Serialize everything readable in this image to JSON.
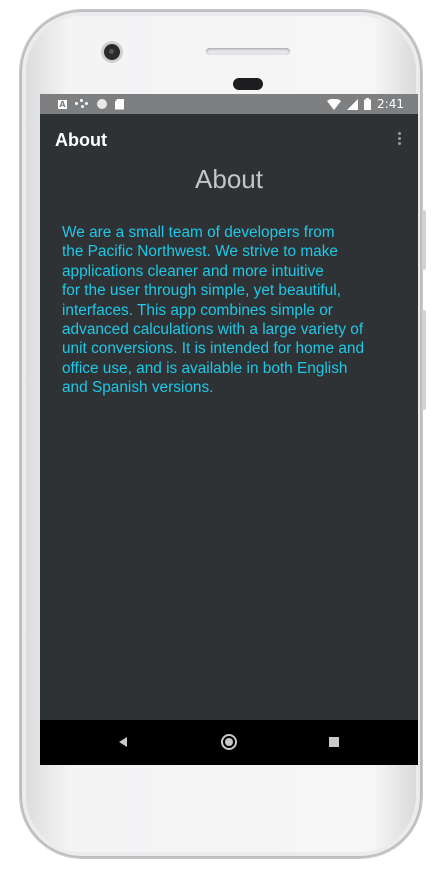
{
  "status_bar": {
    "notification_icons": [
      "a-badge-icon",
      "assistant-dots-icon",
      "sync-circle-icon",
      "sd-card-icon"
    ],
    "time": "2:41",
    "right_icons": [
      "wifi-icon",
      "cell-signal-icon",
      "battery-icon"
    ]
  },
  "app_bar": {
    "title": "About",
    "menu_icon": "overflow-menu-icon"
  },
  "content": {
    "heading": "About",
    "lines": [
      "We are a small team of developers from",
      "the Pacific Northwest. We strive to make",
      "applications cleaner and more intuitive",
      "for the user through simple, yet beautiful,",
      "interfaces. This app combines simple or",
      "advanced calculations with a large variety of",
      "unit conversions. It is intended for home and",
      "office use, and is available in both English",
      "and Spanish versions."
    ]
  },
  "nav_bar": {
    "buttons": [
      "back-icon",
      "home-icon",
      "recents-icon"
    ]
  },
  "colors": {
    "background": "#2f3235",
    "text_accent": "#1ec8e6",
    "heading": "#c2c6c9",
    "status_bar": "#7d7f81",
    "nav_bar": "#000000"
  }
}
